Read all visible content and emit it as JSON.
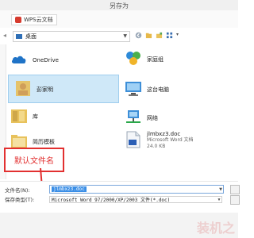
{
  "window": {
    "title": "另存为"
  },
  "toolbar": {
    "wps_label": "WPS云文档"
  },
  "address": {
    "location": "桌面"
  },
  "items": {
    "onedrive": {
      "label": "OneDrive"
    },
    "homegroup": {
      "label": "家庭组"
    },
    "user": {
      "label": "彭家明"
    },
    "thispc": {
      "label": "这台电脑"
    },
    "library": {
      "label": "库"
    },
    "network": {
      "label": "网络"
    },
    "template": {
      "label": "简历模板"
    },
    "docfile": {
      "label": "jlmbxz3.doc",
      "type": "Microsoft Word 文档",
      "size": "24.0 KB"
    }
  },
  "annotation": {
    "text": "默认文件名"
  },
  "form": {
    "filename_label": "文件名(N):",
    "filename_value": "jlmbxz3.doc",
    "filetype_label": "保存类型(T):",
    "filetype_value": "Microsoft Word 97/2000/XP/2003 文件(*.doc)"
  },
  "watermark": {
    "text": "装机之"
  },
  "colors": {
    "accent": "#3a8ee6",
    "annotation": "#e23030"
  }
}
